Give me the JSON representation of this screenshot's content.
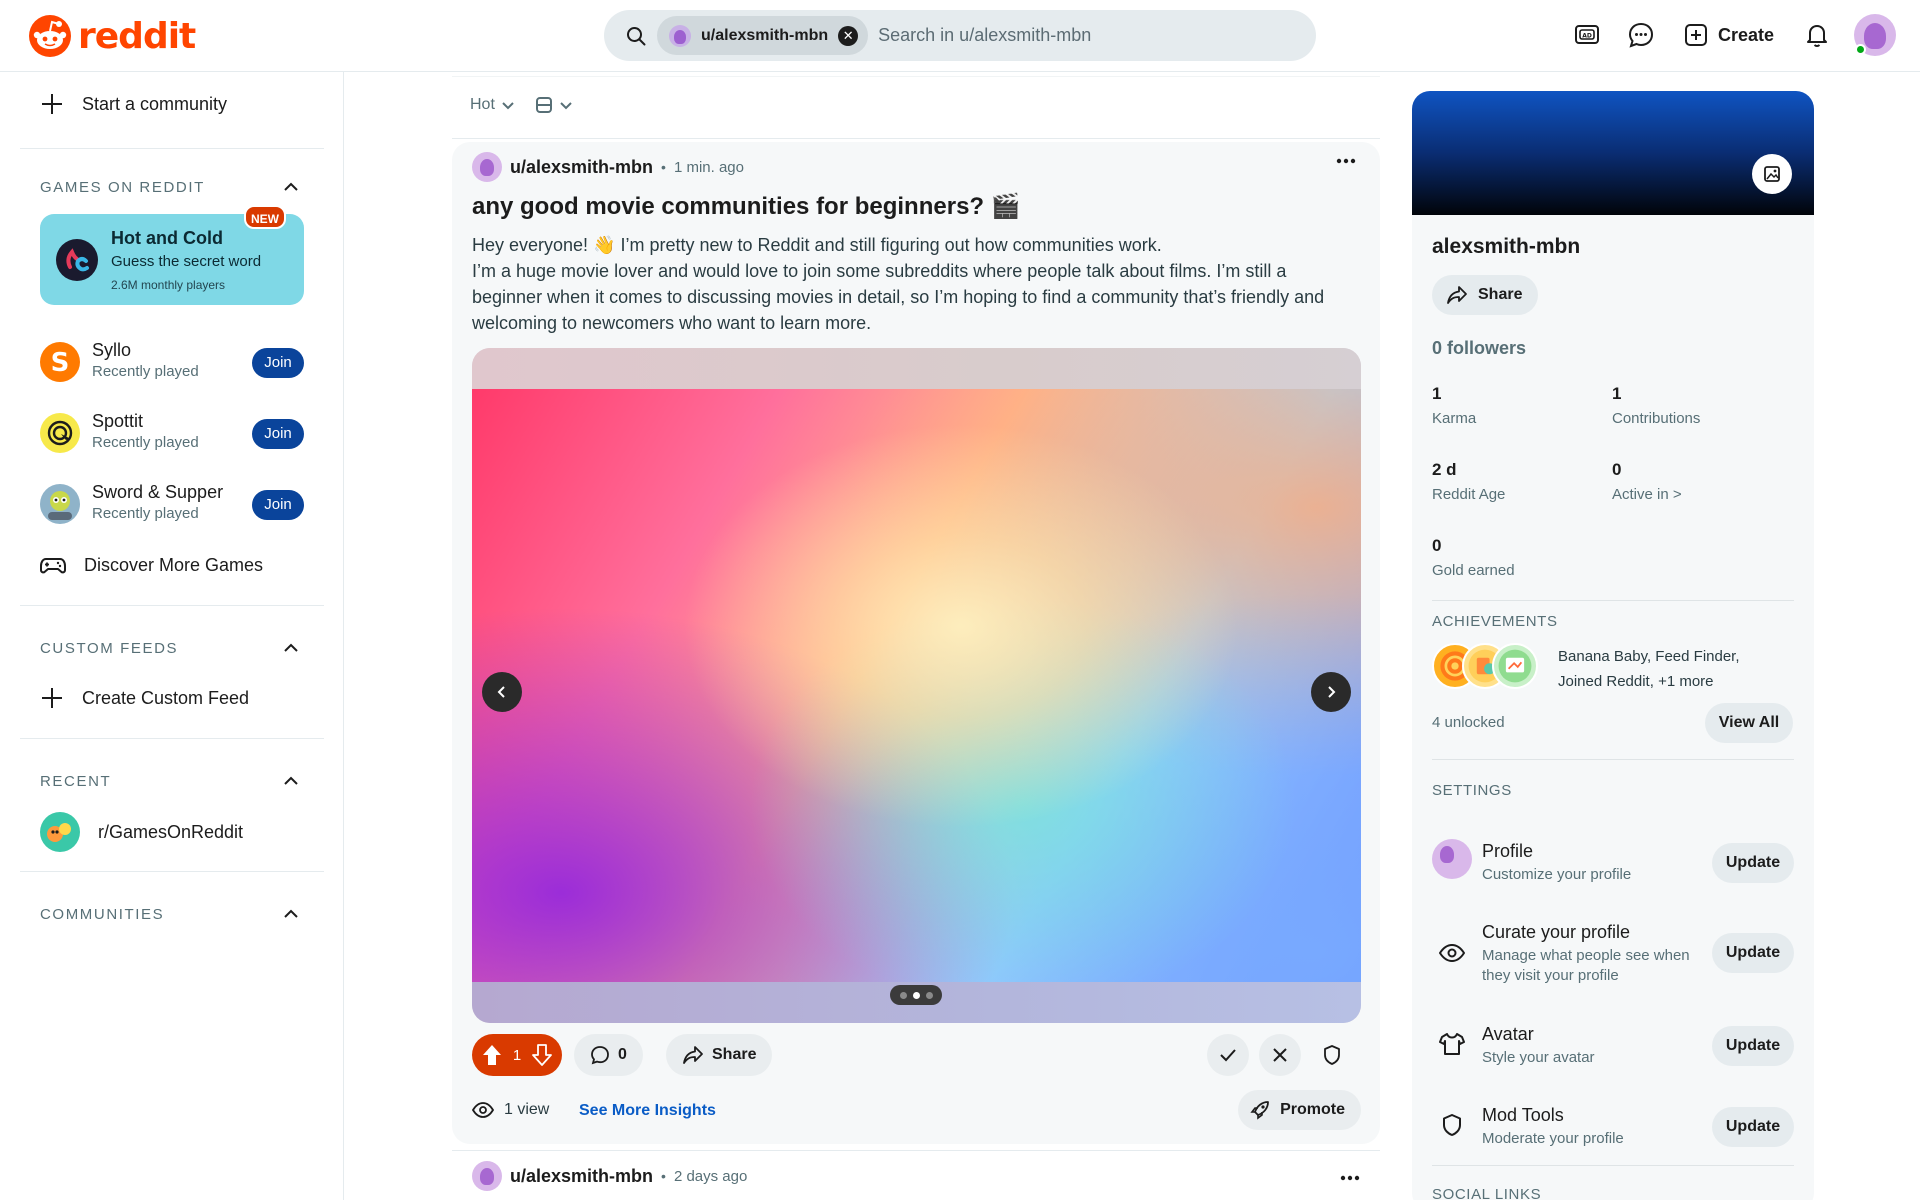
{
  "header": {
    "logo_text": "reddit",
    "search": {
      "chip_label": "u/alexsmith-mbn",
      "placeholder": "Search in u/alexsmith-mbn"
    },
    "create_label": "Create"
  },
  "sidebar": {
    "start_community": "Start a community",
    "games_section": "GAMES ON REDDIT",
    "featured_game": {
      "title": "Hot and Cold",
      "subtitle": "Guess the secret word",
      "meta": "2.6M monthly players",
      "badge": "NEW"
    },
    "games": [
      {
        "name": "Syllo",
        "sub": "Recently played",
        "join": "Join"
      },
      {
        "name": "Spottit",
        "sub": "Recently played",
        "join": "Join"
      },
      {
        "name": "Sword & Supper",
        "sub": "Recently played",
        "join": "Join"
      }
    ],
    "discover_more": "Discover More Games",
    "custom_feeds_section": "CUSTOM FEEDS",
    "create_custom_feed": "Create Custom Feed",
    "recent_section": "RECENT",
    "recent_items": [
      {
        "name": "r/GamesOnReddit"
      }
    ],
    "communities_section": "COMMUNITIES"
  },
  "feed": {
    "sort_label": "Hot",
    "post": {
      "author": "u/alexsmith-mbn",
      "separator": "•",
      "time": "1 min. ago",
      "title": "any good movie communities for beginners? 🎬",
      "body_lines": [
        "Hey everyone! 👋 I’m pretty new to Reddit and still figuring out how communities work.",
        "I’m a huge movie lover and would love to join some subreddits where people talk about films. I’m still a",
        "beginner when it comes to discussing movies in detail, so I’m hoping to find a community that’s friendly and",
        "welcoming to newcomers who want to learn more."
      ],
      "gallery": {
        "current_index": 2,
        "total": 3
      },
      "vote_count": "1",
      "comment_count": "0",
      "share_label": "Share",
      "views": "1 view",
      "see_more_insights": "See More Insights",
      "promote_label": "Promote"
    },
    "next_post": {
      "author": "u/alexsmith-mbn",
      "separator": "•",
      "time": "2 days ago"
    }
  },
  "profile": {
    "name": "alexsmith-mbn",
    "share_label": "Share",
    "followers": "0 followers",
    "stats": [
      {
        "value": "1",
        "label": "Karma"
      },
      {
        "value": "1",
        "label": "Contributions"
      },
      {
        "value": "2 d",
        "label": "Reddit Age"
      },
      {
        "value": "0",
        "label": "Active in >"
      },
      {
        "value": "0",
        "label": "Gold earned"
      }
    ],
    "achievements_section": "ACHIEVEMENTS",
    "achievements_line1": "Banana Baby, Feed Finder,",
    "achievements_line2": "Joined Reddit, +1 more",
    "unlocked": "4 unlocked",
    "view_all": "View All",
    "settings_section": "SETTINGS",
    "settings": [
      {
        "title": "Profile",
        "sub": "Customize your profile",
        "action": "Update"
      },
      {
        "title": "Curate your profile",
        "sub": "Manage what people see when they visit your profile",
        "action": "Update"
      },
      {
        "title": "Avatar",
        "sub": "Style your avatar",
        "action": "Update"
      },
      {
        "title": "Mod Tools",
        "sub": "Moderate your profile",
        "action": "Update"
      }
    ],
    "social_links_section": "SOCIAL LINKS"
  },
  "colors": {
    "brand": "#ff4500",
    "join_button": "#0a449b",
    "upvote_active": "#d93a00",
    "link": "#0a5cc6",
    "game_card": "#7fd8e6"
  },
  "icons": [
    "search-icon",
    "close-icon",
    "advertise-icon",
    "chat-icon",
    "create-icon",
    "bell-icon",
    "plus-icon",
    "chevron-up-icon",
    "gamepad-icon",
    "upvote-icon",
    "downvote-icon",
    "comment-icon",
    "share-icon",
    "check-icon",
    "remove-icon",
    "shield-icon",
    "eye-icon",
    "rocket-icon",
    "image-icon",
    "shirt-icon",
    "more-icon"
  ]
}
